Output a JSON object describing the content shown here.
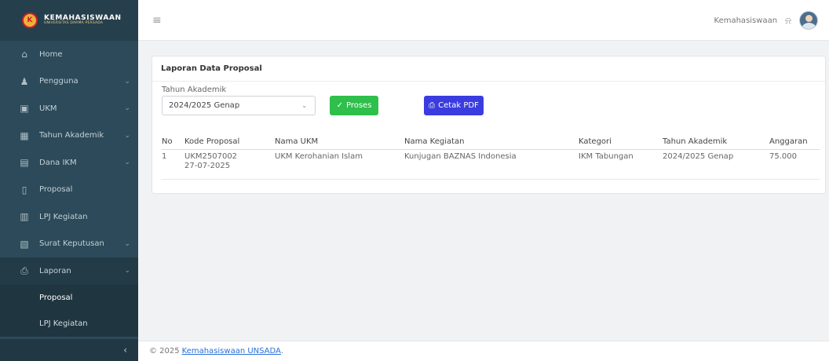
{
  "brand": {
    "logo_glyph": "K",
    "title": "KEMAHASISWAAN",
    "subtitle": "UNIVERSITAS DARMA PERSADA"
  },
  "sidebar": {
    "items": [
      {
        "label": "Home",
        "icon": "home-icon",
        "glyph": "⌂",
        "has_chevron": false
      },
      {
        "label": "Pengguna",
        "icon": "user-icon",
        "glyph": "♟",
        "has_chevron": true
      },
      {
        "label": "UKM",
        "icon": "building-icon",
        "glyph": "▣",
        "has_chevron": true
      },
      {
        "label": "Tahun Akademik",
        "icon": "calendar-icon",
        "glyph": "▦",
        "has_chevron": true
      },
      {
        "label": "Dana IKM",
        "icon": "wallet-icon",
        "glyph": "▤",
        "has_chevron": true
      },
      {
        "label": "Proposal",
        "icon": "document-icon",
        "glyph": "▯",
        "has_chevron": false
      },
      {
        "label": "LPJ Kegiatan",
        "icon": "report-icon",
        "glyph": "▥",
        "has_chevron": false
      },
      {
        "label": "Surat Keputusan",
        "icon": "letter-icon",
        "glyph": "▧",
        "has_chevron": true
      },
      {
        "label": "Laporan",
        "icon": "print-icon",
        "glyph": "⎙",
        "has_chevron": true
      }
    ],
    "chevron_glyph": "⌄",
    "sub_items": [
      {
        "label": "Proposal",
        "active": true
      },
      {
        "label": "LPJ Kegiatan",
        "active": false
      }
    ],
    "collapse_glyph": "‹"
  },
  "topbar": {
    "menu_glyph": "≡",
    "user_name": "Kemahasiswaan",
    "bell_glyph": "⍾"
  },
  "card": {
    "title": "Laporan Data Proposal",
    "filter_label": "Tahun Akademik",
    "select_value": "2024/2025 Genap",
    "select_arrow": "⌄",
    "proses_icon": "✓",
    "proses_label": "Proses",
    "pdf_icon": "⎙",
    "pdf_label": "Cetak PDF"
  },
  "table": {
    "headers": [
      "No",
      "Kode Proposal",
      "Nama UKM",
      "Nama Kegiatan",
      "Kategori",
      "Tahun Akademik",
      "Anggaran"
    ],
    "rows": [
      {
        "no": "1",
        "kode_line1": "UKM2507002",
        "kode_line2": "27-07-2025",
        "ukm": "UKM Kerohanian Islam",
        "kegiatan": "Kunjugan BAZNAS Indonesia",
        "kategori": "IKM Tabungan",
        "tahun": "2024/2025 Genap",
        "anggaran": "75.000"
      }
    ]
  },
  "footer": {
    "copyright": "© 2025",
    "link_label": "Kemahasiswaan UNSADA"
  },
  "colors": {
    "sidebar_bg": "#2c4a59",
    "proses_button": "#2fbf4b",
    "pdf_button": "#3a3ce0",
    "link": "#2a6fd6"
  }
}
